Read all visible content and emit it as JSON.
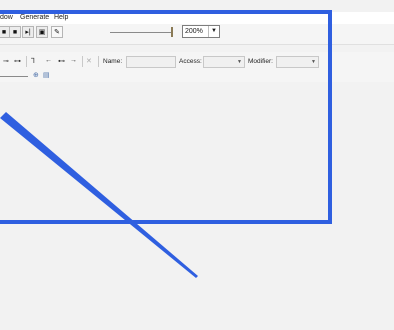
{
  "menu": {
    "items": [
      "dow",
      "Generate",
      "Help"
    ]
  },
  "toolbar": {
    "buttons": [
      {
        "icon": "stop-square-icon",
        "glyph": "■"
      },
      {
        "icon": "stop-icon",
        "glyph": "■"
      },
      {
        "icon": "step-icon",
        "glyph": "▌▌"
      },
      {
        "icon": "save-icon",
        "glyph": "▣"
      },
      {
        "icon": "pencil-icon",
        "glyph": "✎"
      }
    ],
    "zoom_value": "200%"
  },
  "properties": {
    "name_label": "Name:",
    "access_label": "Access:",
    "modifier_label": "Modifier:",
    "name_value": "",
    "access_value": "",
    "modifier_value": ""
  },
  "colors": {
    "annotation": "#2f5fe0"
  }
}
